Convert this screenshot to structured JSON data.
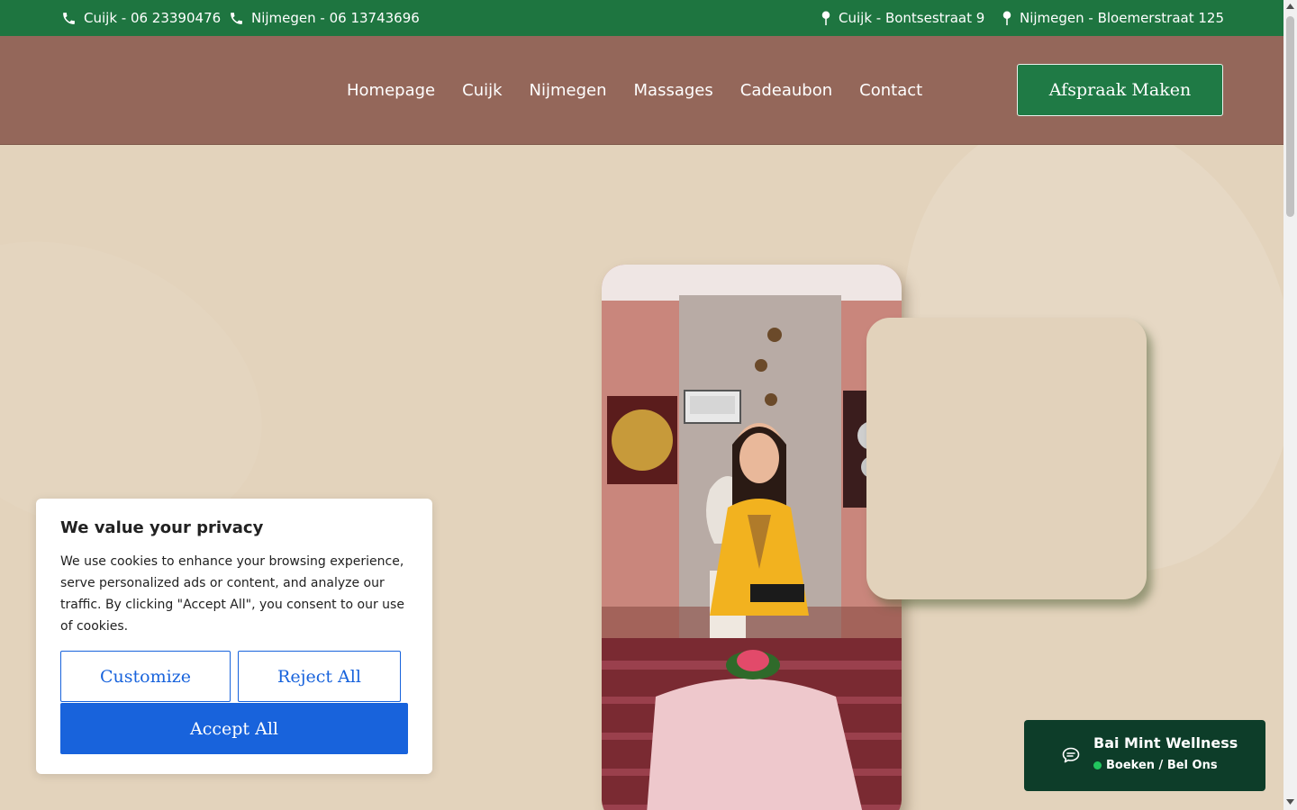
{
  "topbar": {
    "phone_cuijk": "Cuijk - 06 23390476",
    "phone_nijmegen": "Nijmegen - 06 13743696",
    "address_cuijk": "Cuijk - Bontsestraat 9",
    "address_nijmegen": "Nijmegen - Bloemerstraat 125",
    "icons": [
      "phone-icon",
      "location-pin-icon"
    ]
  },
  "nav": {
    "items": [
      "Homepage",
      "Cuijk",
      "Nijmegen",
      "Massages",
      "Cadeaubon",
      "Contact"
    ],
    "cta_label": "Afspraak Maken"
  },
  "cookie": {
    "title": "We value your privacy",
    "text": "We use cookies to enhance your browsing experience, serve personalized ads or content, and analyze our traffic. By clicking \"Accept All\", you consent to our use of cookies.",
    "customize_label": "Customize",
    "reject_label": "Reject All",
    "accept_label": "Accept All"
  },
  "chat": {
    "title": "Bai Mint Wellness",
    "subtitle": "Boeken / Bel Ons",
    "icon": "chat-bubble-icon"
  },
  "colors": {
    "topbar": "#1e7540",
    "header": "#94675a",
    "hero_bg": "#e3d3bc",
    "cta": "#1f7a45",
    "cookie_accent": "#1863dc",
    "chat_bg": "#0d3d29"
  }
}
